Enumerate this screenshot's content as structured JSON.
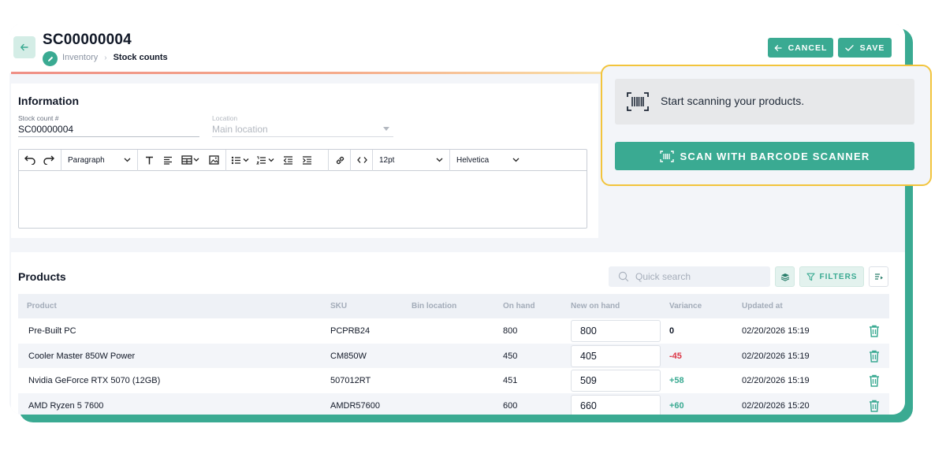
{
  "header": {
    "title": "SC00000004",
    "breadcrumb": [
      "Inventory",
      "Stock counts"
    ],
    "breadcrumb_separator": "›",
    "cancel_label": "CANCEL",
    "save_label": "SAVE"
  },
  "information": {
    "title": "Information",
    "stock_count_label": "Stock count #",
    "stock_count_value": "SC00000004",
    "location_label": "Location",
    "location_value": "Main location",
    "toolbar": {
      "block_format": "Paragraph",
      "font_size": "12pt",
      "font_family": "Helvetica"
    }
  },
  "scan": {
    "message": "Start scanning your products.",
    "button_label": "SCAN WITH BARCODE SCANNER"
  },
  "products": {
    "title": "Products",
    "search_placeholder": "Quick search",
    "filters_label": "FILTERS",
    "columns": [
      "Product",
      "SKU",
      "Bin location",
      "On hand",
      "New on hand",
      "Variance",
      "Updated at"
    ],
    "rows": [
      {
        "product": "Pre-Built PC",
        "sku": "PCPRB24",
        "bin": "",
        "on_hand": "800",
        "new_on_hand": "800",
        "variance": "0",
        "updated_at": "02/20/2026 15:19"
      },
      {
        "product": "Cooler Master 850W Power",
        "sku": "CM850W",
        "bin": "",
        "on_hand": "450",
        "new_on_hand": "405",
        "variance": "-45",
        "updated_at": "02/20/2026 15:19"
      },
      {
        "product": "Nvidia GeForce RTX 5070 (12GB)",
        "sku": "507012RT",
        "bin": "",
        "on_hand": "451",
        "new_on_hand": "509",
        "variance": "+58",
        "updated_at": "02/20/2026 15:19"
      },
      {
        "product": "AMD Ryzen 5 7600",
        "sku": "AMDR57600",
        "bin": "",
        "on_hand": "600",
        "new_on_hand": "660",
        "variance": "+60",
        "updated_at": "02/20/2026 15:20"
      }
    ]
  },
  "colors": {
    "accent": "#3aaa92",
    "highlight_border": "#f2c43c",
    "negative": "#dc3545",
    "positive": "#3aaa92"
  }
}
